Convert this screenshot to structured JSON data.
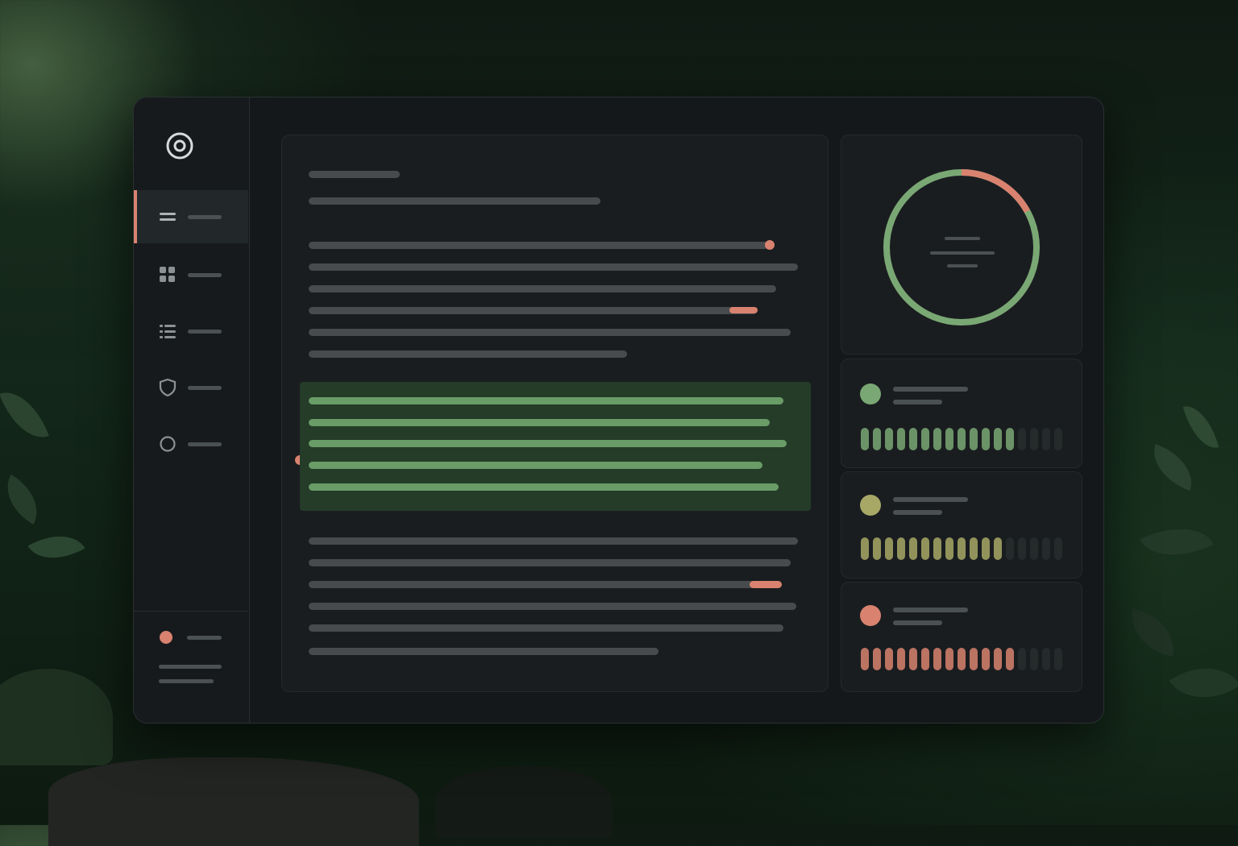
{
  "colors": {
    "accent": "#d8826f",
    "green": "#7aa874",
    "olive": "#a8a866",
    "coral": "#d8826f",
    "bar_inactive": "#252a2b"
  },
  "sidebar": {
    "logo_icon": "target-icon",
    "items": [
      {
        "icon": "menu-icon",
        "label": "",
        "active": true
      },
      {
        "icon": "grid-icon",
        "label": "",
        "active": false
      },
      {
        "icon": "list-icon",
        "label": "",
        "active": false
      },
      {
        "icon": "shield-icon",
        "label": "",
        "active": false
      },
      {
        "icon": "circle-icon",
        "label": "",
        "active": false
      }
    ],
    "footer": {
      "status_color": "#d8826f",
      "name": "",
      "detail_1": "",
      "detail_2": ""
    }
  },
  "document": {
    "title": "",
    "subtitle": "",
    "paragraph_1": [
      "",
      "",
      "",
      "",
      "",
      ""
    ],
    "highlight": [
      "",
      "",
      "",
      "",
      ""
    ],
    "paragraph_2": [
      "",
      "",
      "",
      "",
      "",
      ""
    ]
  },
  "progress_ring": {
    "fraction_alert": 0.17,
    "color_main": "#7aa874",
    "color_alert": "#d8826f",
    "center_lines": [
      "",
      "",
      ""
    ]
  },
  "stats": [
    {
      "color": "#7aa874",
      "label": "",
      "sublabel": "",
      "filled": 13,
      "total": 17
    },
    {
      "color": "#a8a866",
      "label": "",
      "sublabel": "",
      "filled": 12,
      "total": 17
    },
    {
      "color": "#d8826f",
      "label": "",
      "sublabel": "",
      "filled": 13,
      "total": 17
    }
  ]
}
